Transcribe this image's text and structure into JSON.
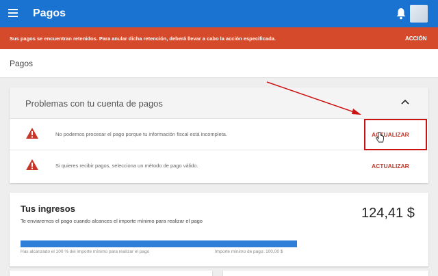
{
  "appbar": {
    "title": "Pagos",
    "menu_icon": "menu-icon",
    "bell_icon": "bell-icon",
    "color": "#1a73d0"
  },
  "alert": {
    "text": "Sus pagos se encuentran retenidos. Para anular dicha retención, deberá llevar a cabo la acción especificada.",
    "action": "ACCIÓN",
    "color": "#d44a2a"
  },
  "page": {
    "title": "Pagos"
  },
  "problems": {
    "title": "Problemas con tu cuenta de pagos",
    "items": [
      {
        "icon": "warning-icon",
        "text": "No podemos procesar el pago porque tu información fiscal está incompleta.",
        "action": "ACTUALIZAR"
      },
      {
        "icon": "warning-icon",
        "text": "Si quieres recibir pagos, selecciona un método de pago válido.",
        "action": "ACTUALIZAR"
      }
    ]
  },
  "income": {
    "title": "Tus ingresos",
    "subtitle": "Te enviaremos el pago cuando alcances el importe mínimo para realizar el pago",
    "amount": "124,41 $",
    "progress_percent": 100,
    "progress_left_label": "Has alcanzado el 100 % del importe mínimo para realizar el pago",
    "progress_right_label": "Importe mínimo de pago: 100,00 $"
  },
  "colors": {
    "accent": "#c0392b",
    "progress": "#2f7ed8",
    "annotation": "#cc1111"
  }
}
